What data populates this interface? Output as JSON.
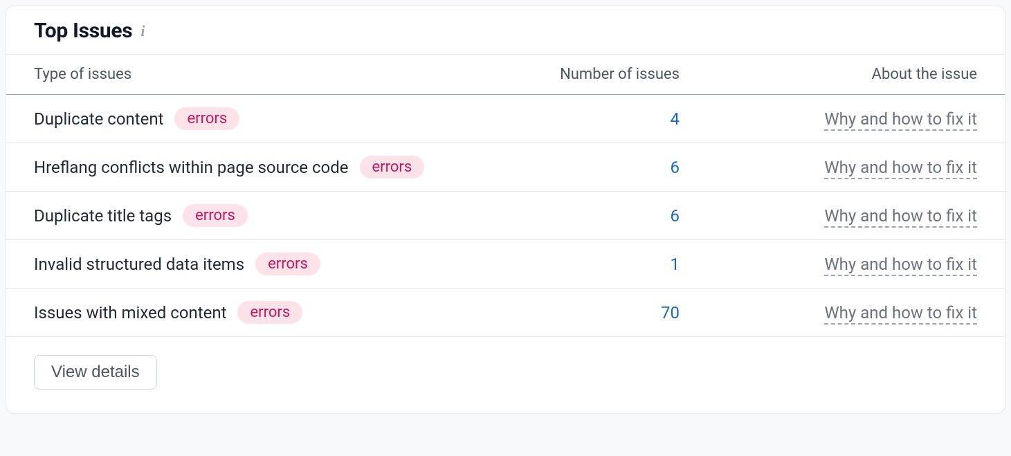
{
  "card": {
    "title": "Top Issues",
    "info_glyph": "i"
  },
  "columns": {
    "type": "Type of issues",
    "number": "Number of issues",
    "about": "About the issue"
  },
  "badge_label": "errors",
  "about_link_label": "Why and how to fix it",
  "issues": [
    {
      "name": "Duplicate content",
      "count": "4"
    },
    {
      "name": "Hreflang conflicts within page source code",
      "count": "6"
    },
    {
      "name": "Duplicate title tags",
      "count": "6"
    },
    {
      "name": "Invalid structured data items",
      "count": "1"
    },
    {
      "name": "Issues with mixed content",
      "count": "70"
    }
  ],
  "footer": {
    "view_details": "View details"
  }
}
